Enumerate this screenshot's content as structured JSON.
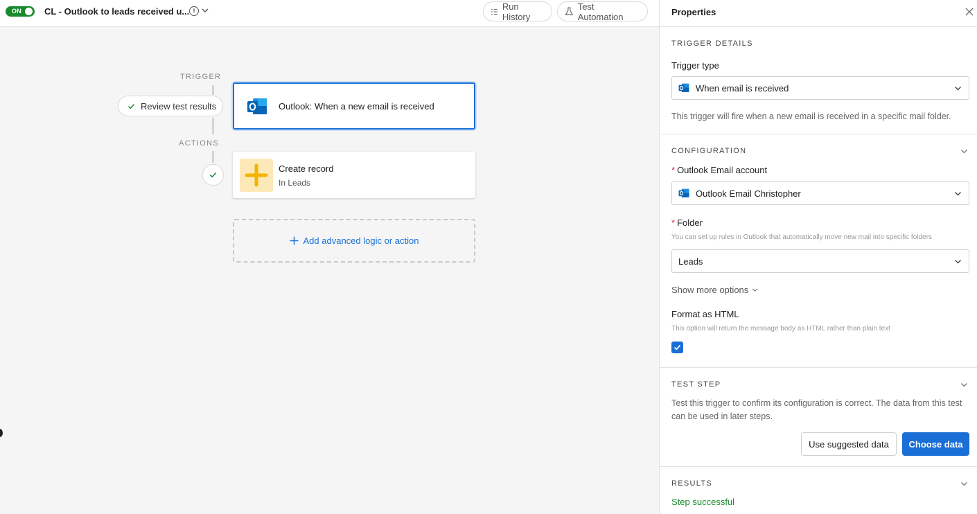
{
  "header": {
    "toggle_label": "ON",
    "flow_title": "CL - Outlook to leads received u...",
    "run_history": "Run History",
    "test_automation": "Test Automation"
  },
  "canvas": {
    "trigger_section": "TRIGGER",
    "actions_section": "ACTIONS",
    "review_test_results": "Review test results",
    "trigger_node_title": "Outlook: When a new email is received",
    "action_node_title": "Create record",
    "action_node_subtitle": "In Leads",
    "add_logic": "Add advanced logic or action"
  },
  "panel": {
    "title": "Properties",
    "trigger_details": {
      "section_title": "TRIGGER DETAILS",
      "trigger_type_label": "Trigger type",
      "trigger_type_value": "When email is received",
      "description": "This trigger will fire when a new email is received in a specific mail folder."
    },
    "configuration": {
      "section_title": "CONFIGURATION",
      "account_label": "Outlook Email account",
      "account_value": "Outlook Email Christopher",
      "folder_label": "Folder",
      "folder_help": "You can set up rules in Outlook that automatically move new mail into specific folders",
      "folder_value": "Leads",
      "show_more": "Show more options",
      "format_html_label": "Format as HTML",
      "format_html_help": "This option will return the message body as HTML rather than plain text"
    },
    "test_step": {
      "section_title": "TEST STEP",
      "description": "Test this trigger to confirm its configuration is correct. The data from this test can be used in later steps.",
      "use_suggested": "Use suggested data",
      "choose_data": "Choose data"
    },
    "results": {
      "section_title": "RESULTS",
      "status": "Step successful"
    }
  },
  "colors": {
    "accent": "#1a6fd6",
    "success": "#1a8a2e",
    "action_icon_bg": "#fde9b8",
    "action_icon_plus": "#f5b300"
  }
}
